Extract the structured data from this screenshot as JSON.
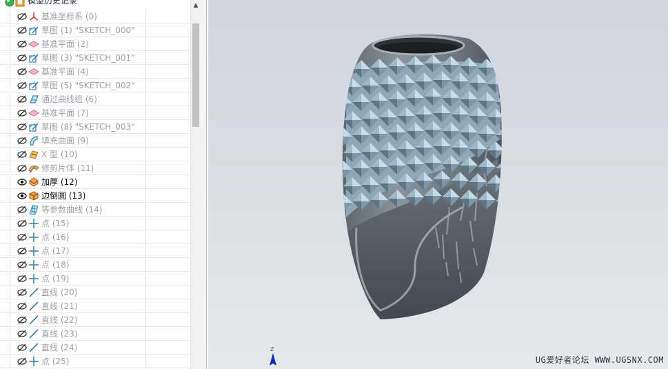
{
  "navigator": {
    "root_label": "模型历史记录",
    "features": [
      {
        "label": "基准坐标系 (0)",
        "icon": "datum-csys-icon",
        "state": "hidden"
      },
      {
        "label": "草图 (1) \"SKETCH_000\"",
        "icon": "sketch-icon",
        "state": "hidden"
      },
      {
        "label": "基准平面 (2)",
        "icon": "datum-plane-icon",
        "state": "hidden"
      },
      {
        "label": "草图 (3) \"SKETCH_001\"",
        "icon": "sketch-icon",
        "state": "hidden"
      },
      {
        "label": "基准平面 (4)",
        "icon": "datum-plane-icon",
        "state": "hidden"
      },
      {
        "label": "草图 (5) \"SKETCH_002\"",
        "icon": "sketch-icon",
        "state": "hidden"
      },
      {
        "label": "通过曲线组 (6)",
        "icon": "through-curves-icon",
        "state": "hidden"
      },
      {
        "label": "基准平面 (7)",
        "icon": "datum-plane-icon",
        "state": "hidden"
      },
      {
        "label": "草图 (8) \"SKETCH_003\"",
        "icon": "sketch-icon",
        "state": "hidden"
      },
      {
        "label": "填充曲面 (9)",
        "icon": "fill-surface-icon",
        "state": "hidden"
      },
      {
        "label": "X 型 (10)",
        "icon": "x-form-icon",
        "state": "hidden"
      },
      {
        "label": "修剪片体 (11)",
        "icon": "trim-sheet-icon",
        "state": "hidden"
      },
      {
        "label": "加厚 (12)",
        "icon": "thicken-icon",
        "state": "shown"
      },
      {
        "label": "边倒圆 (13)",
        "icon": "edge-blend-icon",
        "state": "shown"
      },
      {
        "label": "等参数曲线 (14)",
        "icon": "isoparametric-curve-icon",
        "state": "hidden"
      },
      {
        "label": "点 (15)",
        "icon": "point-icon",
        "state": "hidden"
      },
      {
        "label": "点 (16)",
        "icon": "point-icon",
        "state": "hidden"
      },
      {
        "label": "点 (17)",
        "icon": "point-icon",
        "state": "hidden"
      },
      {
        "label": "点 (18)",
        "icon": "point-icon",
        "state": "hidden"
      },
      {
        "label": "点 (19)",
        "icon": "point-icon",
        "state": "hidden"
      },
      {
        "label": "直线 (20)",
        "icon": "line-icon",
        "state": "hidden"
      },
      {
        "label": "直线 (21)",
        "icon": "line-icon",
        "state": "hidden"
      },
      {
        "label": "直线 (22)",
        "icon": "line-icon",
        "state": "hidden"
      },
      {
        "label": "直线 (23)",
        "icon": "line-icon",
        "state": "hidden"
      },
      {
        "label": "直线 (24)",
        "icon": "line-icon",
        "state": "hidden"
      },
      {
        "label": "点 (25)",
        "icon": "point-icon",
        "state": "hidden"
      }
    ]
  },
  "viewport": {
    "triad_axis_label": "Z",
    "watermark": "UG爱好者论坛 WWW.UGSNX.COM",
    "colors": {
      "vase_body": "#7d868c",
      "vase_facets_light": "#b9d3e6",
      "triad_z": "#0a2cc8"
    }
  },
  "icons": {
    "hidden_toggle": "eye-hidden-icon",
    "shown_toggle": "eye-visible-icon",
    "root": "model-history-icon",
    "scroll_up": "chevron-up-icon"
  }
}
